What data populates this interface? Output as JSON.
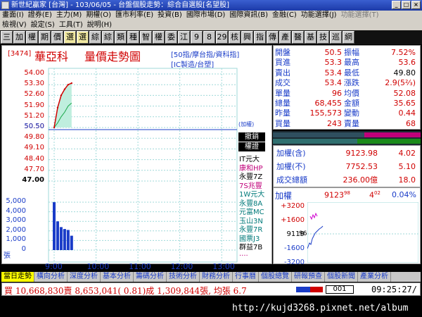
{
  "window": {
    "title": "新世紀贏家 [台灣] - 103/06/05 - 台盤個股走勢：綜合自選股[名望股]",
    "minimize": "_",
    "maximize": "□",
    "close": "×"
  },
  "menu1": [
    "畫面(I)",
    "證券(E)",
    "主力(M)",
    "期權(O)",
    "匯市利率(E)",
    "投資(B)",
    "國際市場(D)",
    "國際資訊(B)",
    "金融(C)",
    "功能選擇(J)"
  ],
  "menu1_grey": [
    "功能選擇(T)"
  ],
  "menu2": [
    "檢視(V)",
    "設定(S)",
    "工具(T)",
    "說明(H)"
  ],
  "toolbar": [
    "三",
    "加",
    "權",
    "期",
    "價",
    "選",
    "選",
    "綜",
    "綜",
    "類",
    "種",
    "智",
    "權",
    "委",
    "江",
    "9",
    "8",
    "29",
    "核",
    "興",
    "指",
    "傳",
    "產",
    "醫",
    "基",
    "技",
    "巡",
    "網"
  ],
  "stock": {
    "code": "[3474]",
    "name": "華亞科",
    "chart_title": "量價走勢圖",
    "index_info1": "[50指/摩台指/資科指]",
    "index_info2": "[IC製造/台塑]"
  },
  "y_labels": [
    "54.00",
    "53.30",
    "52.60",
    "51.90",
    "51.20",
    "50.50",
    "49.80",
    "49.10",
    "48.40",
    "47.70",
    "47.00"
  ],
  "ref_label": "50.50",
  "ref_tag": "(加權)",
  "vol_labels": [
    "5,000",
    "4,000",
    "3,000",
    "2,000",
    "1,000",
    "0"
  ],
  "vol_unit": "張",
  "x_labels": [
    "9:00",
    "10:00",
    "11:00",
    "12:00",
    "13:00"
  ],
  "brokers": {
    "tags": [
      "撤銷",
      "權證"
    ],
    "items": [
      {
        "name": "IT元大",
        "color": "#000000"
      },
      {
        "name": "康和HP",
        "color": "#c0007a"
      },
      {
        "name": "永豐7Z",
        "color": "#000000"
      },
      {
        "name": "7S兆豐",
        "color": "#c0007a"
      },
      {
        "name": "1W元大",
        "color": "#007a7a"
      },
      {
        "name": "永豐8A",
        "color": "#007a7a"
      },
      {
        "name": "元富MC",
        "color": "#007a7a"
      },
      {
        "name": "玉山3N",
        "color": "#007a7a"
      },
      {
        "name": "永豐7R",
        "color": "#007a7a"
      },
      {
        "name": "國票J3",
        "color": "#007a7a"
      },
      {
        "name": "群益7B",
        "color": "#000000"
      },
      {
        "name": "....",
        "color": "#c0007a"
      }
    ]
  },
  "quote": {
    "rows": [
      {
        "l": "開盤",
        "v": "50.5",
        "r": "振幅",
        "rv": "7.52%"
      },
      {
        "l": "買進",
        "v": "53.3",
        "r": "最高",
        "rv": "53.6"
      },
      {
        "l": "賣出",
        "v": "53.4",
        "r": "最低",
        "rv": "49.80"
      },
      {
        "l": "成交",
        "v": "53.4",
        "r": "漲跌",
        "rv": "2.9(5⅔)"
      },
      {
        "l": "單量",
        "v": "96",
        "r": "均價",
        "rv": "52.08"
      },
      {
        "l": "總量",
        "v": "68,455",
        "r": "金額",
        "rv": "35.65"
      },
      {
        "l": "昨量",
        "v": "155,573",
        "r": "變動",
        "rv": "0.44"
      },
      {
        "l": "買量",
        "v": "243",
        "r": "賣量",
        "rv": "68"
      }
    ]
  },
  "index_box": [
    {
      "l": "加權(含)",
      "v": "9123.98",
      "c": "4.02"
    },
    {
      "l": "加權(不)",
      "v": "7752.53",
      "c": "5.10"
    },
    {
      "l": "成交總額",
      "v": "236.00億",
      "c": "18.0"
    }
  ],
  "mini": {
    "title": "加權",
    "value": "9123",
    "value_suffix": "98",
    "count": "4",
    "count_suffix": "02",
    "pct": "0.04%",
    "y_labels": [
      "+3200",
      "+1600",
      "9119",
      "-1600",
      "-3200"
    ],
    "y_marker": "96"
  },
  "tabs": [
    "當日走勢",
    "橫向分析",
    "深度分析",
    "基本分析",
    "籌碼分析",
    "技術分析",
    "財務分析",
    "行事曆",
    "個股總覽",
    "研報預查",
    "個股新聞",
    "產業分析"
  ],
  "status": {
    "ticker": "買 10,668,830賣 8,653,041( 0.81)成 1,309,844張, 均張 6.7",
    "code": "001",
    "clock": "09:25:27/"
  },
  "footer": {
    "url": "http://kujd3268.pixnet.net/album"
  },
  "chart_data": {
    "type": "line",
    "title": "量價走勢圖",
    "ylim": [
      47.0,
      54.0
    ],
    "reference": 50.5,
    "x": [
      "9:00",
      "9:05",
      "9:10",
      "9:15",
      "9:20",
      "9:25"
    ],
    "series": [
      {
        "values": [
          50.5,
          51.8,
          52.6,
          53.0,
          53.3,
          53.4
        ]
      },
      {
        "values": [
          50.5,
          50.8,
          51.2,
          51.5,
          51.9,
          52.1
        ]
      }
    ],
    "volume": [
      5000,
      3000,
      2400,
      2200,
      2100,
      1500
    ],
    "volume_ylim": [
      0,
      5000
    ]
  }
}
